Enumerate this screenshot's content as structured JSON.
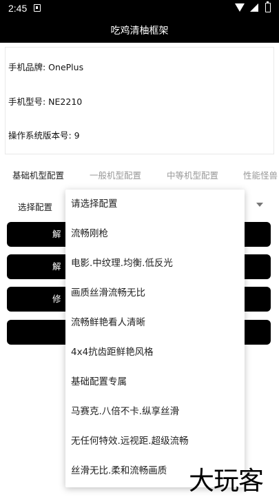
{
  "status_bar": {
    "time": "2:45"
  },
  "app_bar": {
    "title": "吃鸡清柚框架"
  },
  "device_info": {
    "brand": "手机品牌: OnePlus",
    "model": "手机型号: NE2210",
    "os_version": "操作系统版本号: 9"
  },
  "tabs": [
    "基础机型配置",
    "一般机型配置",
    "中等机型配置",
    "性能怪兽"
  ],
  "select": {
    "label": "选择配置"
  },
  "buttons": [
    "解",
    "解",
    "修",
    ""
  ],
  "dropdown": {
    "options": [
      "请选择配置",
      "流畅刚枪",
      "电影.中纹理.均衡.低反光",
      "画质丝滑流畅无比",
      "流畅鲜艳看人清晰",
      "4x4抗齿距鲜艳风格",
      "基础配置专属",
      "马赛克.八倍不卡.纵享丝滑",
      "无任何特效.远视距.超级流畅",
      "丝滑无比.柔和流畅画质"
    ]
  },
  "watermark": "大玩客"
}
